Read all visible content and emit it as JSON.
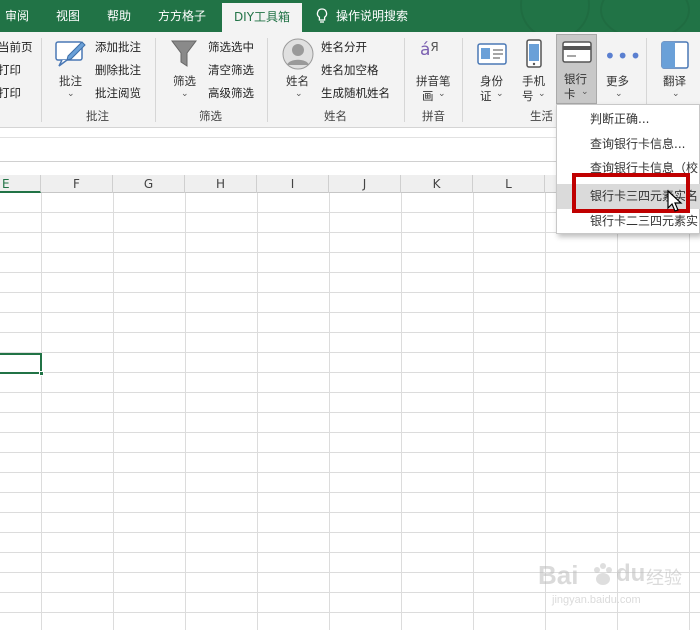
{
  "tabs": [
    {
      "label": "审阅"
    },
    {
      "label": "视图"
    },
    {
      "label": "帮助"
    },
    {
      "label": "方方格子"
    },
    {
      "label": "DIY工具箱"
    },
    {
      "label": "操作说明搜索"
    }
  ],
  "ribbon": {
    "page": {
      "items": [
        "当前页",
        "打印",
        "打印"
      ]
    },
    "comment": {
      "big": "批注",
      "items": [
        "添加批注",
        "删除批注",
        "批注阅览"
      ],
      "group": "批注"
    },
    "filter": {
      "big": "筛选",
      "items": [
        "筛选选中",
        "清空筛选",
        "高级筛选"
      ],
      "group": "筛选"
    },
    "name": {
      "big": "姓名",
      "items": [
        "姓名分开",
        "姓名加空格",
        "生成随机姓名"
      ],
      "group": "姓名"
    },
    "pinyin": {
      "big1": "拼音笔",
      "big2": "画",
      "group": "拼音"
    },
    "life": {
      "id1": "身份",
      "id2": "证",
      "phone1": "手机",
      "phone2": "号",
      "bank1": "银行",
      "bank2": "卡",
      "more": "更多",
      "group": "生活"
    },
    "translate": {
      "label": "翻译"
    }
  },
  "columns": [
    "E",
    "F",
    "G",
    "H",
    "I",
    "J",
    "K",
    "L"
  ],
  "menu": {
    "items": [
      "判断正确...",
      "查询银行卡信息...",
      "查询银行卡信息（校",
      "银行卡三四元素实名",
      "银行卡二三四元素实"
    ]
  },
  "colors": {
    "accent": "#217346",
    "highlight": "#c00000"
  },
  "watermark": {
    "brand": "Bai",
    "brand2": "du",
    "suffix": "经验",
    "url": "jingyan.baidu.com"
  }
}
